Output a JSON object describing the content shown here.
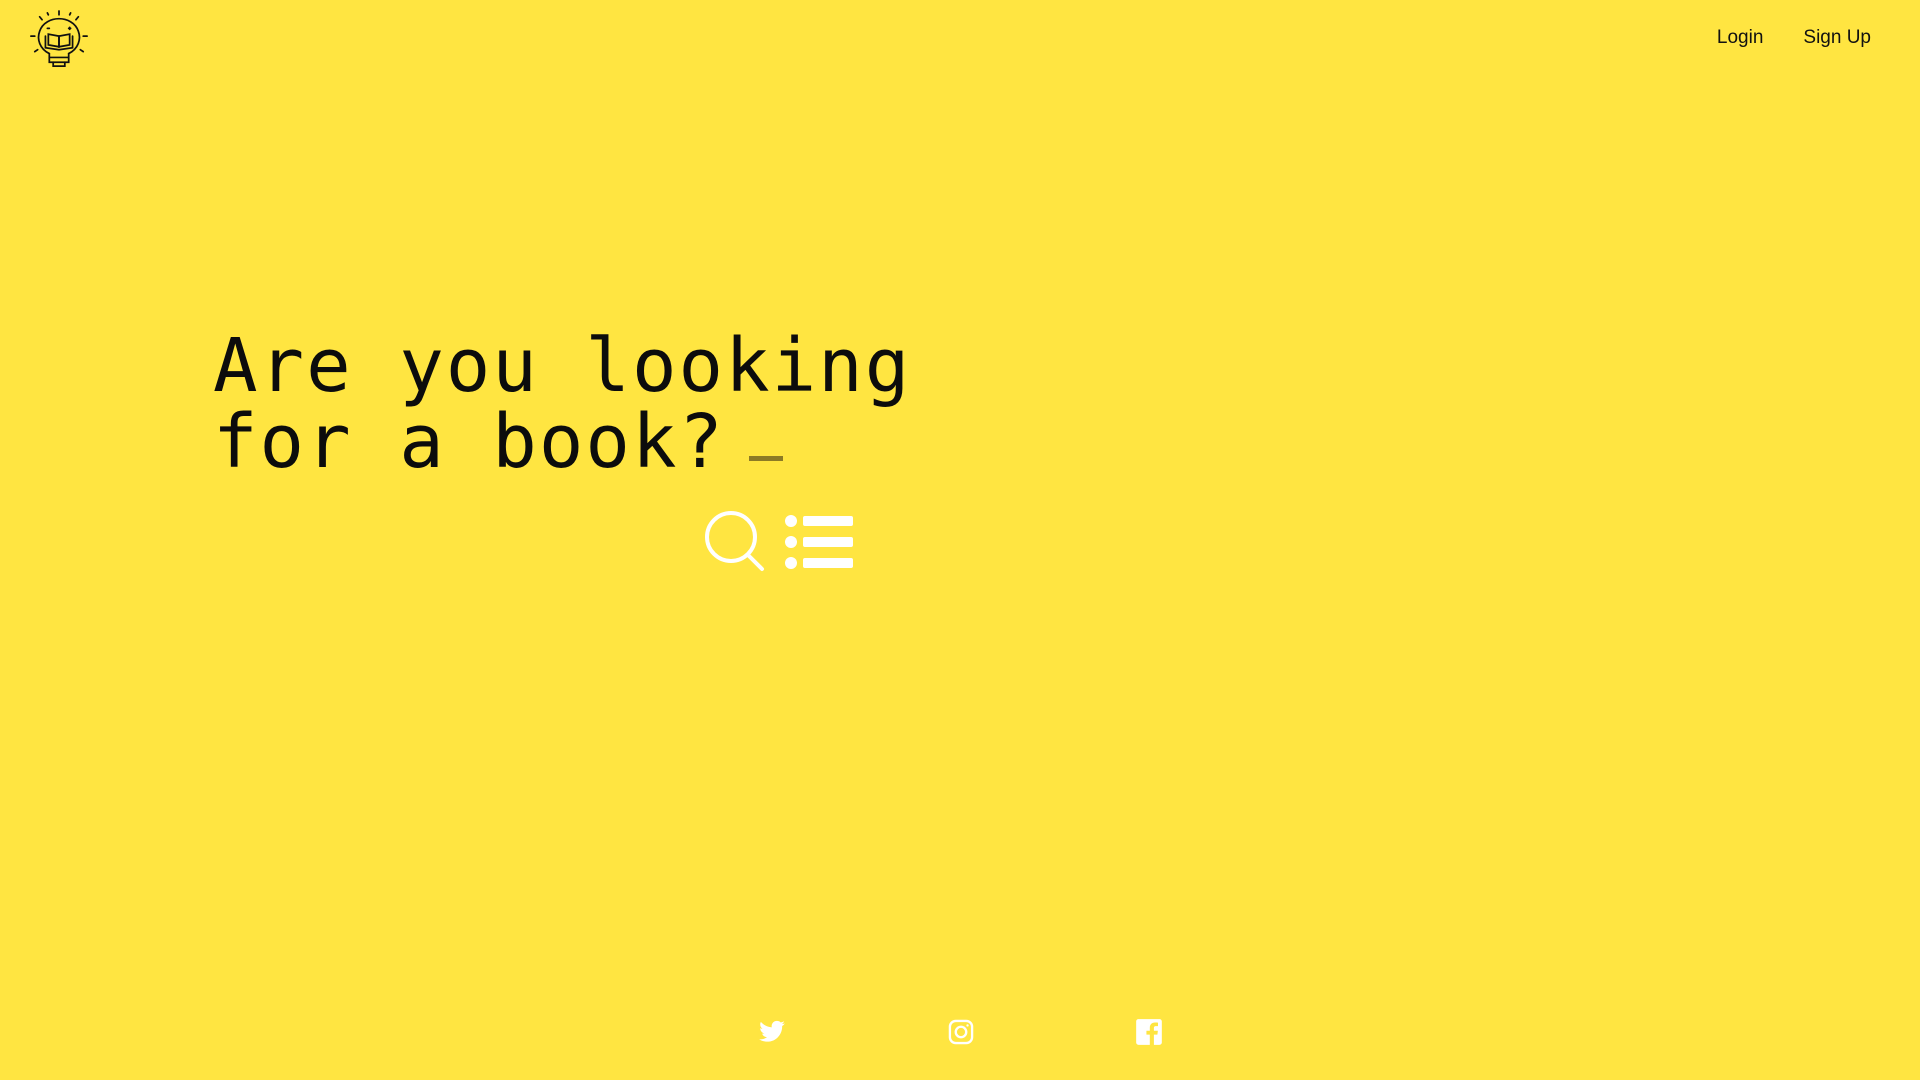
{
  "header": {
    "logo_icon": "lightbulb-book-icon",
    "nav": {
      "login_label": "Login",
      "signup_label": "Sign Up"
    }
  },
  "hero": {
    "line1": "Are you looking",
    "line2": "for a book?",
    "cursor_color": "#8c7a25"
  },
  "actions": {
    "search_icon": "search-icon",
    "list_icon": "list-icon"
  },
  "footer": {
    "social_icons": [
      "twitter-icon",
      "instagram-icon",
      "facebook-icon"
    ]
  },
  "colors": {
    "background": "#FFE541",
    "text": "#111111",
    "icons": "#FFFFFF"
  }
}
